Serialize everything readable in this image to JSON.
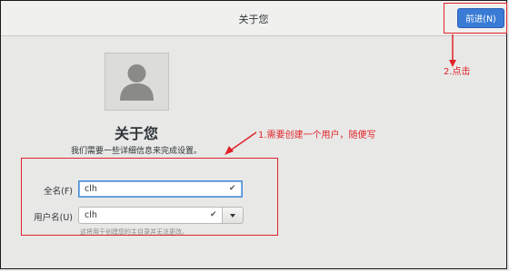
{
  "header": {
    "title": "关于您",
    "next_label": "前进(N)"
  },
  "main": {
    "heading": "关于您",
    "subtitle": "我们需要一些详细信息来完成设置。",
    "full_name": {
      "label": "全名(F)",
      "value": "clh"
    },
    "username": {
      "label": "用户名(U)",
      "value": "clh"
    },
    "hint": "这将用于创建您的主目录并无法更改。"
  },
  "annotations": {
    "step1": "1.需要创建一个用户，随便写",
    "step2": "2.点击",
    "color": "#e2232a"
  },
  "icons": {
    "avatar": "user-silhouette-icon",
    "valid": "check-icon",
    "dropdown": "chevron-down-icon"
  }
}
